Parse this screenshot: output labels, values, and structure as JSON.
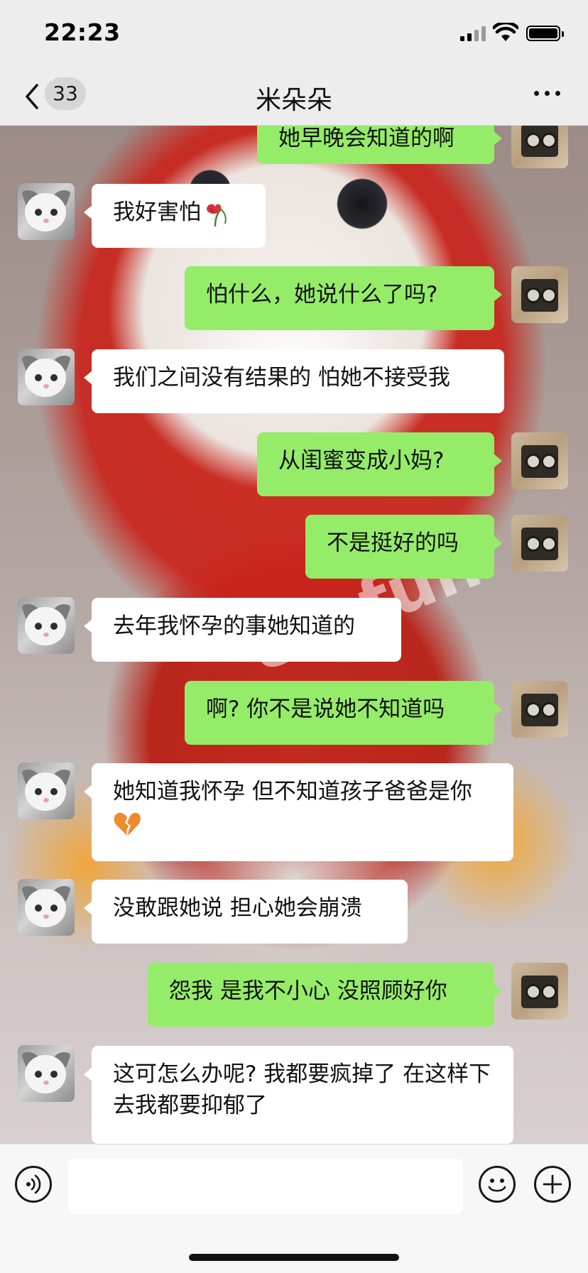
{
  "status_bar": {
    "time": "22:23"
  },
  "nav": {
    "badge_count": "33",
    "title": "米朵朵"
  },
  "watermark": "88.fun",
  "messages": [
    {
      "side": "out",
      "text": "她早晚会知道的啊"
    },
    {
      "side": "in",
      "text": "我好害怕",
      "emoji": "wilted-flower"
    },
    {
      "side": "out",
      "text": "怕什么，她说什么了吗?"
    },
    {
      "side": "in",
      "text": "我们之间没有结果的 怕她不接受我"
    },
    {
      "side": "out",
      "text": "从闺蜜变成小妈?"
    },
    {
      "side": "out",
      "text": "不是挺好的吗"
    },
    {
      "side": "in",
      "text": "去年我怀孕的事她知道的"
    },
    {
      "side": "out",
      "text": "啊? 你不是说她不知道吗"
    },
    {
      "side": "in",
      "text": "她知道我怀孕 但不知道孩子爸爸是你",
      "emoji": "broken-heart"
    },
    {
      "side": "in",
      "text": "没敢跟她说 担心她会崩溃"
    },
    {
      "side": "out",
      "text": "怨我 是我不小心 没照顾好你"
    },
    {
      "side": "in",
      "text": "这可怎么办呢? 我都要疯掉了 在这样下去我都要抑郁了"
    }
  ],
  "input": {
    "value": "",
    "placeholder": ""
  },
  "icons": {
    "back": "chevron-left-icon",
    "more": "more-icon",
    "voice": "voice-icon",
    "emoji": "emoji-icon",
    "plus": "plus-icon"
  },
  "colors": {
    "outgoing_bubble": "#95ec69",
    "incoming_bubble": "#ffffff",
    "bar_bg": "#ededed"
  }
}
